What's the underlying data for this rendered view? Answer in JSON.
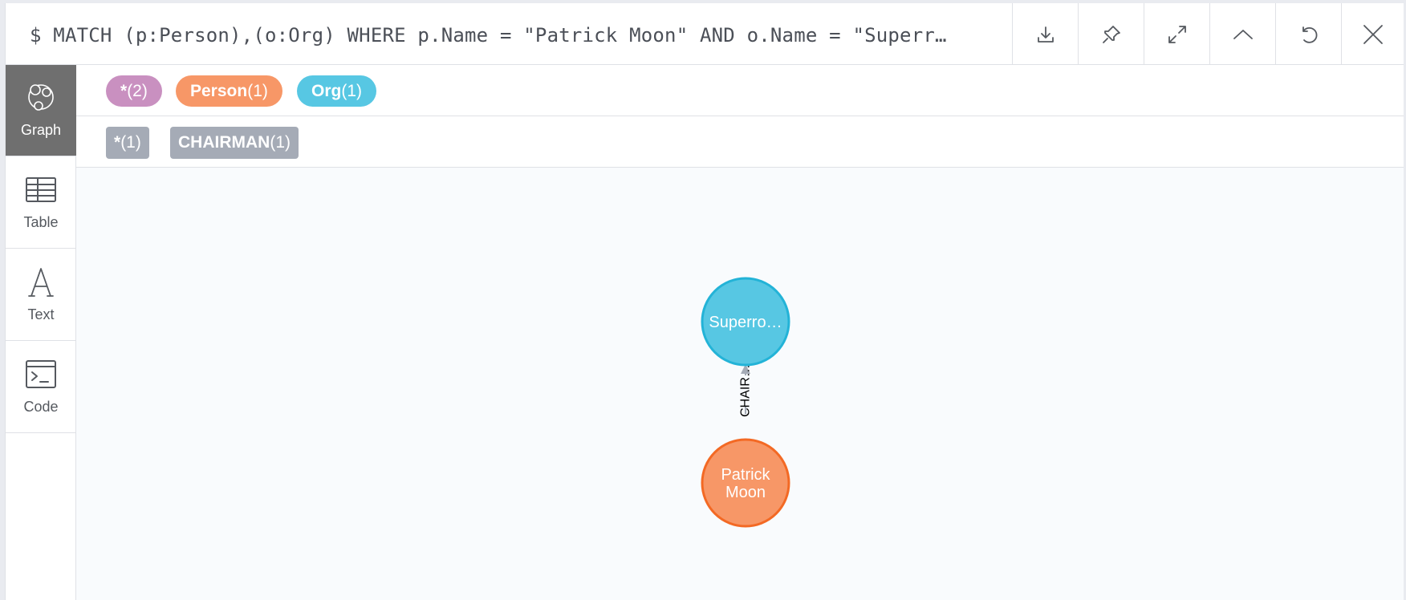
{
  "query": "$ MATCH (p:Person),(o:Org) WHERE p.Name = \"Patrick Moon\" AND o.Name = \"Superr…",
  "toolbar": {
    "download": "download-icon",
    "pin": "pin-icon",
    "expand": "expand-icon",
    "collapse": "chevron-up-icon",
    "rerun": "refresh-icon",
    "close": "close-icon"
  },
  "sidebar": {
    "items": [
      {
        "label": "Graph",
        "icon": "graph-icon",
        "active": true
      },
      {
        "label": "Table",
        "icon": "table-icon",
        "active": false
      },
      {
        "label": "Text",
        "icon": "text-icon",
        "active": false
      },
      {
        "label": "Code",
        "icon": "code-icon",
        "active": false
      }
    ]
  },
  "node_labels": [
    {
      "name": "*",
      "count": "(2)",
      "color": "#c990c0"
    },
    {
      "name": "Person",
      "count": "(1)",
      "color": "#f79767"
    },
    {
      "name": "Org",
      "count": "(1)",
      "color": "#57c7e3"
    }
  ],
  "relationship_types": [
    {
      "name": "*",
      "count": "(1)",
      "color": "#a5abb6"
    },
    {
      "name": "CHAIRMAN",
      "count": "(1)",
      "color": "#a5abb6"
    }
  ],
  "graph": {
    "org_node": {
      "caption": "Superro…",
      "fill": "#57c7e3",
      "stroke": "#23b3d7"
    },
    "person_node": {
      "caption_line1": "Patrick",
      "caption_line2": "Moon",
      "fill": "#f79767",
      "stroke": "#f36924"
    },
    "relationship": {
      "caption": "CHAIR…",
      "color": "#a5abb6"
    }
  }
}
